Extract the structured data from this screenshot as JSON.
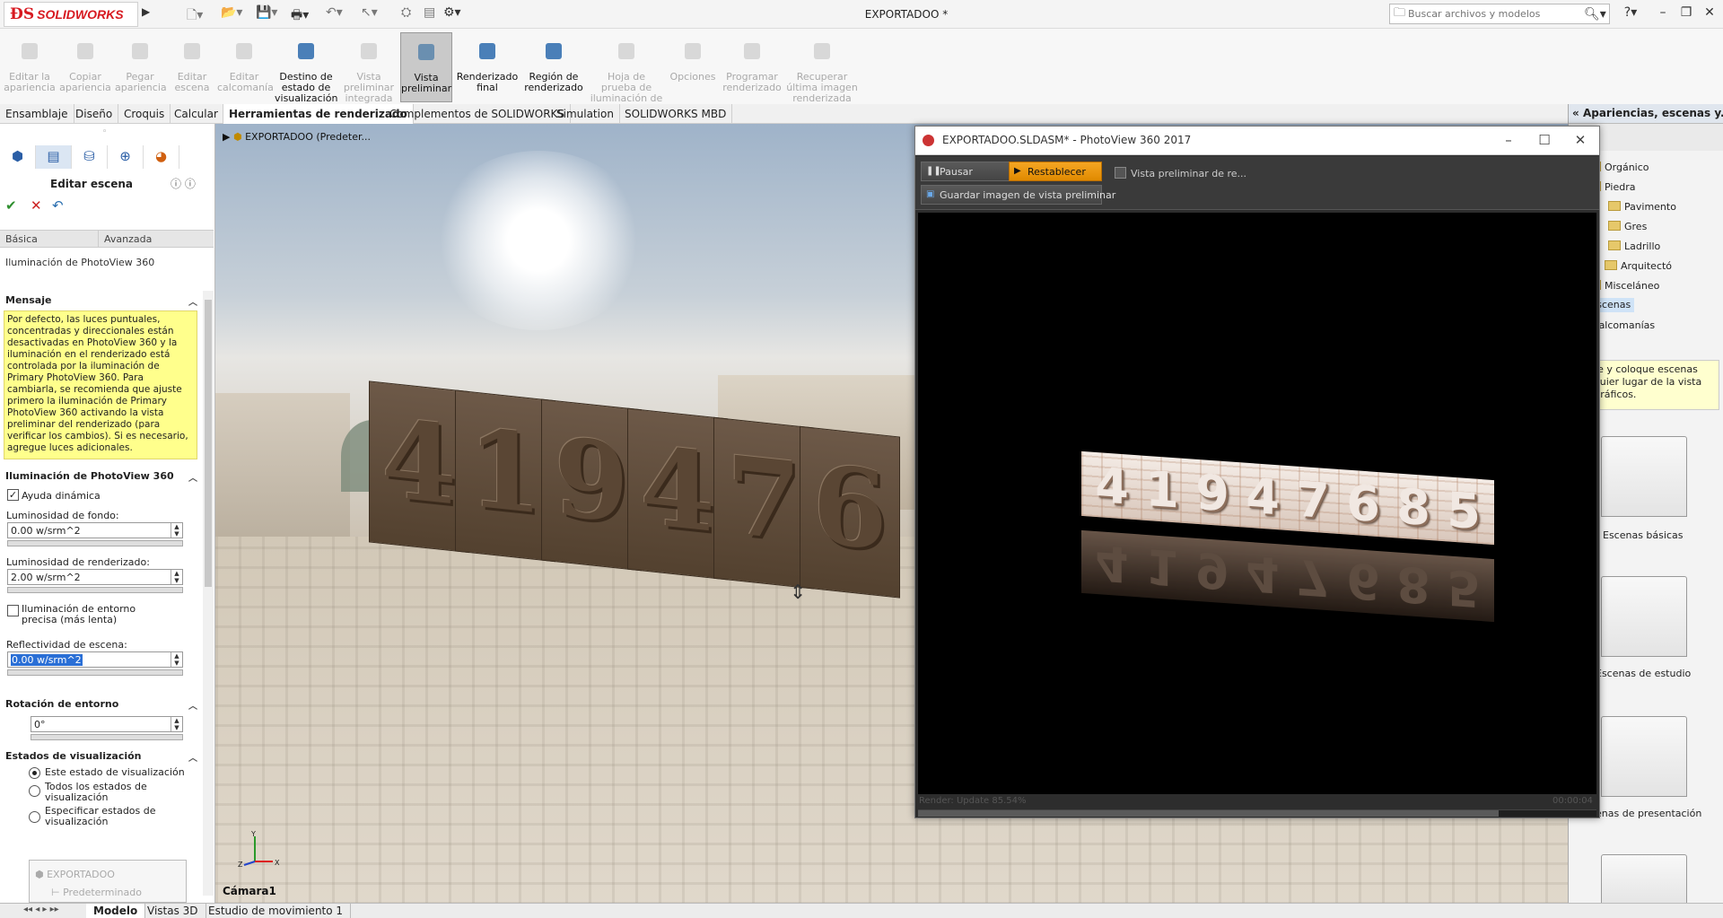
{
  "app": {
    "brand": "SOLIDWORKS",
    "doc_title": "EXPORTADOO *"
  },
  "search": {
    "placeholder": "Buscar archivos y modelos"
  },
  "commands": [
    {
      "label": "Editar la apariencia",
      "enabled": false
    },
    {
      "label": "Copiar apariencia",
      "enabled": false
    },
    {
      "label": "Pegar apariencia",
      "enabled": false
    },
    {
      "label": "Editar escena",
      "enabled": false
    },
    {
      "label": "Editar calcomanía",
      "enabled": false
    },
    {
      "label": "Destino de estado de visualización",
      "enabled": true
    },
    {
      "label": "Vista preliminar integrada",
      "enabled": false
    },
    {
      "label": "Vista preliminar",
      "enabled": true,
      "selected": true
    },
    {
      "label": "Renderizado final",
      "enabled": true
    },
    {
      "label": "Región de renderizado",
      "enabled": true
    },
    {
      "label": "Hoja de prueba de iluminación de la escena",
      "enabled": false
    },
    {
      "label": "Opciones",
      "enabled": false
    },
    {
      "label": "Programar renderizado",
      "enabled": false
    },
    {
      "label": "Recuperar última imagen renderizada",
      "enabled": false
    }
  ],
  "cm_tabs": [
    "Ensamblaje",
    "Diseño",
    "Croquis",
    "Calcular",
    "Herramientas de renderizado",
    "Complementos de SOLIDWORKS",
    "Simulation",
    "SOLIDWORKS MBD"
  ],
  "cm_active_tab": "Herramientas de renderizado",
  "property_manager": {
    "title": "Editar escena",
    "tabs": [
      "Básica",
      "Avanzada"
    ],
    "subtitle": "Iluminación de PhotoView 360",
    "message_header": "Mensaje",
    "message": "Por defecto, las luces puntuales, concentradas y direccionales están desactivadas en PhotoView 360 y la iluminación en el renderizado está controlada por la iluminación de Primary PhotoView 360. Para cambiarla, se recomienda que ajuste primero la iluminación de Primary PhotoView 360 activando la vista preliminar del renderizado (para verificar los cambios). Si es necesario, agregue luces adicionales.",
    "lighting_header": "Iluminación de PhotoView 360",
    "dynamic_help": "Ayuda dinámica",
    "dynamic_help_checked": true,
    "bg_brightness_label": "Luminosidad de fondo:",
    "bg_brightness": "0.00 w/srm^2",
    "render_brightness_label": "Luminosidad de renderizado:",
    "render_brightness": "2.00 w/srm^2",
    "precise_env_label": "Iluminación de entorno precisa (más lenta)",
    "precise_env_checked": false,
    "scene_reflectivity_label": "Reflectividad de escena:",
    "scene_reflectivity": "0.00 w/srm^2",
    "env_rotation_header": "Rotación de entorno",
    "env_rotation": "0°",
    "display_states_header": "Estados de visualización",
    "display_states": [
      {
        "label": "Este estado de visualización",
        "selected": true
      },
      {
        "label": "Todos los estados de visualización",
        "selected": false
      },
      {
        "label": "Especificar estados de visualización",
        "selected": false
      }
    ],
    "tree_root": "EXPORTADOO",
    "tree_child": "Predeterminado"
  },
  "viewport": {
    "tree_label": "EXPORTADOO  (Predeter...",
    "camera_label": "Cámara1",
    "model_digits": [
      "4",
      "1",
      "9",
      "4",
      "7",
      "6"
    ],
    "triad": {
      "x": "X",
      "y": "Y",
      "z": "Z"
    }
  },
  "photoview": {
    "title": "EXPORTADOO.SLDASM* - PhotoView 360 2017",
    "pause": "Pausar",
    "reset": "Restablecer",
    "save_preview": "Guardar imagen de vista preliminar",
    "preview_option": "Vista preliminar de re...",
    "render_digits": [
      "4",
      "1",
      "9",
      "4",
      "7",
      "6",
      "8",
      "5"
    ],
    "status": "Render: Update 85.54%",
    "progress": 0.8554,
    "elapsed": "00:00:04"
  },
  "taskpane": {
    "title": "Apariencias, escenas y...",
    "tree": [
      {
        "label": "Orgánico",
        "level": 1,
        "expanded": false
      },
      {
        "label": "Piedra",
        "level": 1,
        "expanded": true
      },
      {
        "label": "Pavimento",
        "level": 2
      },
      {
        "label": "Gres",
        "level": 2
      },
      {
        "label": "Ladrillo",
        "level": 2
      },
      {
        "label": "Arquitectó",
        "level": 2,
        "expanded": false
      },
      {
        "label": "Misceláneo",
        "level": 1,
        "expanded": false
      },
      {
        "label": "Escenas",
        "level": 0,
        "selected": true
      },
      {
        "label": "Calcomanías",
        "level": 0
      }
    ],
    "tip": "astre y coloque escenas ualquier lugar de la vista de gráficos.",
    "folders": [
      "Escenas básicas",
      "Escenas de estudio",
      "enas de presentación"
    ]
  },
  "bottom_tabs": [
    "Modelo",
    "Vistas 3D",
    "Estudio de movimiento 1"
  ],
  "bottom_active_tab": "Modelo"
}
